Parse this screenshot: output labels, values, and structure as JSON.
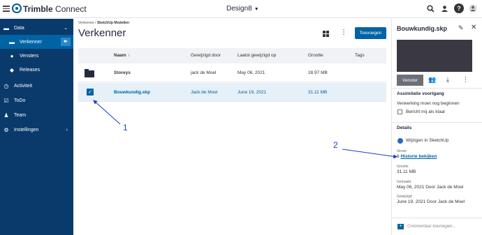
{
  "topbar": {
    "brand_bold": "Trimble",
    "brand_rest": " Connect",
    "project": "Design8",
    "icons": [
      "hamburger-icon",
      "search-icon",
      "user-icon",
      "help-icon",
      "avatar-icon"
    ]
  },
  "sidebar": {
    "items": [
      {
        "label": "Data",
        "icon": "folder-icon"
      },
      {
        "label": "Verkenner",
        "icon": "folder-open-icon"
      },
      {
        "label": "Vensters",
        "icon": "camera-icon"
      },
      {
        "label": "Releases",
        "icon": "release-icon"
      },
      {
        "label": "Activiteit",
        "icon": "history-icon"
      },
      {
        "label": "ToDo",
        "icon": "checkbox-icon"
      },
      {
        "label": "Team",
        "icon": "team-icon"
      },
      {
        "label": "Instellingen",
        "icon": "gear-icon"
      }
    ]
  },
  "main": {
    "breadcrumb_root": "Verkenner",
    "breadcrumb_sep": " / ",
    "breadcrumb_current": "SketchUp Modellen",
    "title": "Verkenner",
    "add_button": "Toevoegen",
    "columns": {
      "name": "Naam",
      "modified_by": "Gewijzigd door",
      "modified_on": "Laatst gewijzigd op",
      "size": "Grootte",
      "tags": "Tags"
    },
    "rows": [
      {
        "name": "Storeys",
        "modified_by": "jack de Moel",
        "modified_on": "May 06, 2021",
        "size": "28.97 MB",
        "type": "folder",
        "selected": false
      },
      {
        "name": "Bouwkundig.skp",
        "modified_by": "Jack de Moel",
        "modified_on": "June 19, 2021",
        "size": "31.11 MB",
        "type": "file",
        "selected": true
      }
    ]
  },
  "annotations": {
    "one": "1",
    "two": "2"
  },
  "panel": {
    "title": "Bouwkundig.skp",
    "venster_label": "Venster",
    "assimilation_heading": "Assimilatie voortgang",
    "assimilation_status": "Verwerking moet nog beginnen",
    "notify_label": "Bericht mij als klaar",
    "details_heading": "Details",
    "edit_in_sketchup": "Wijzigen in SketchUp",
    "version_label": "Versie",
    "version_value": "6",
    "history_link": "Historie bekijken",
    "size_label": "Grootte",
    "size_value": "31.11 MB",
    "created_label": "Gemaakt",
    "created_value": "May 06, 2021 Door Jack de Moel",
    "modified_label": "Gewijzigd",
    "modified_value": "June 19, 2021 Door Jack de Moel",
    "comment_placeholder": "Commentaar toevoegen..."
  },
  "colors": {
    "sidebar_bg": "#0a3a6b",
    "accent": "#0063a3",
    "selected_row": "#e5f0f9",
    "annotation": "#1a3cc8"
  }
}
